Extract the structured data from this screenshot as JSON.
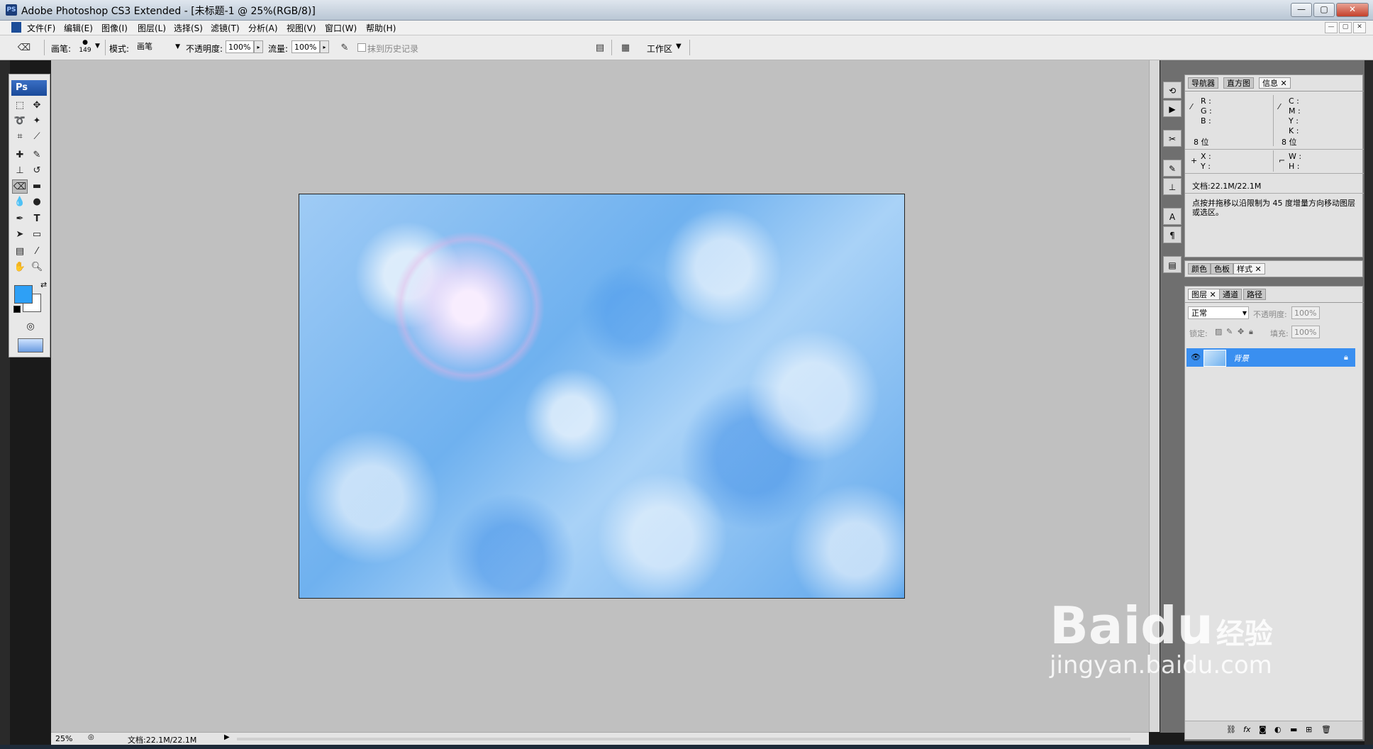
{
  "window": {
    "app_icon": "PS",
    "title": "Adobe Photoshop CS3 Extended - [未标题-1 @ 25%(RGB/8)]",
    "controls": {
      "minimize": "—",
      "maximize": "▢",
      "close": "✕"
    }
  },
  "menubar": {
    "items": [
      "文件(F)",
      "编辑(E)",
      "图像(I)",
      "图层(L)",
      "选择(S)",
      "滤镜(T)",
      "分析(A)",
      "视图(V)",
      "窗口(W)",
      "帮助(H)"
    ],
    "doc_controls": [
      "—",
      "▢",
      "✕"
    ]
  },
  "options": {
    "brush_label": "画笔:",
    "brush_size": "149",
    "mode_label": "模式:",
    "mode_value": "画笔",
    "opacity_label": "不透明度:",
    "opacity_value": "100%",
    "flow_label": "流量:",
    "flow_value": "100%",
    "erase_history_label": "抹到历史记录",
    "workspace_label": "工作区"
  },
  "toolbox": {
    "header": "Ps"
  },
  "colors": {
    "foreground": "#2ea0f6",
    "background": "#ffffff",
    "layer_selected": "#3a8ff0"
  },
  "status": {
    "zoom": "25%",
    "doc_info": "文档:22.1M/22.1M"
  },
  "info_panel": {
    "tabs": [
      "导航器",
      "直方图",
      "信息"
    ],
    "rgb_labels": [
      "R :",
      "G :",
      "B :"
    ],
    "cmyk_labels": [
      "C :",
      "M :",
      "Y :",
      "K :"
    ],
    "bits_left": "8 位",
    "bits_right": "8 位",
    "xy_labels": [
      "X :",
      "Y :"
    ],
    "wh_labels": [
      "W :",
      "H :"
    ],
    "doc_size": "文档:22.1M/22.1M",
    "hint": "点按并拖移以沿限制为 45 度增量方向移动图层或选区。"
  },
  "swatches_panel": {
    "tabs": [
      "颜色",
      "色板",
      "样式"
    ]
  },
  "layers_panel": {
    "tabs": [
      "图层",
      "通道",
      "路径"
    ],
    "blend_mode": "正常",
    "opacity_label": "不透明度:",
    "opacity_value": "100%",
    "lock_label": "锁定:",
    "fill_label": "填充:",
    "fill_value": "100%",
    "layer_name": "背景"
  },
  "watermark": {
    "brand": "Baidu",
    "brand_cn": "经验",
    "url": "jingyan.baidu.com"
  }
}
